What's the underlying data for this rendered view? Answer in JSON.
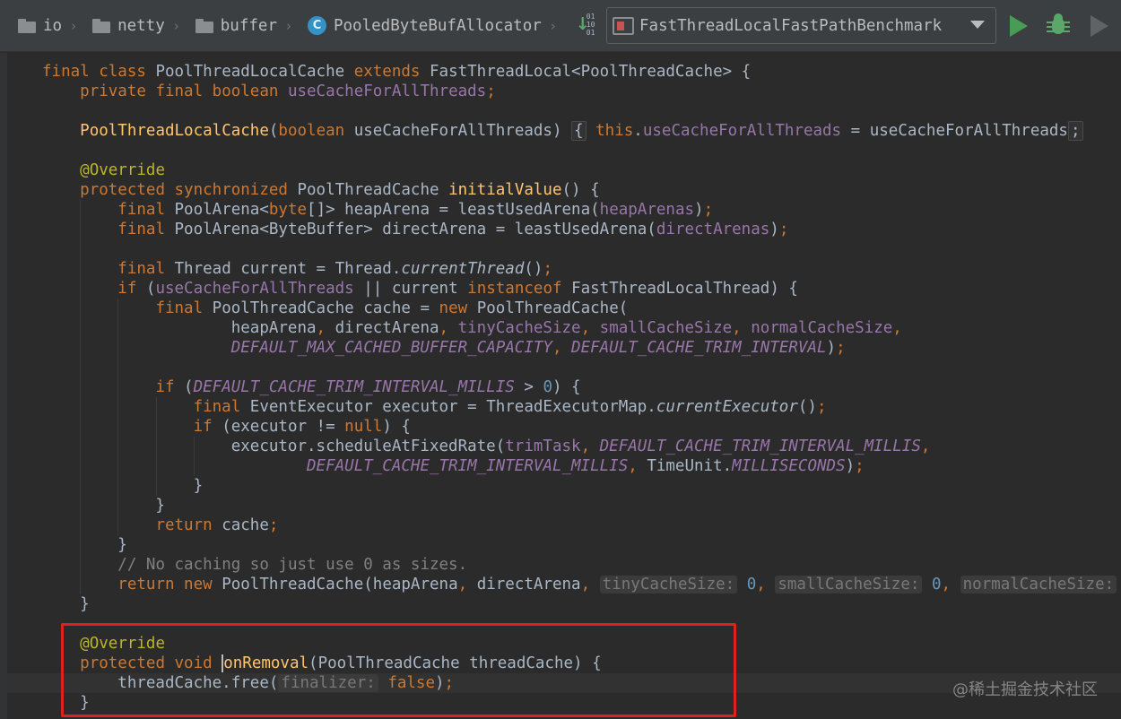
{
  "navbar": {
    "breadcrumbs": [
      {
        "label": "io",
        "icon": "folder-icon"
      },
      {
        "label": "netty",
        "icon": "folder-icon"
      },
      {
        "label": "buffer",
        "icon": "folder-icon"
      },
      {
        "label": "PooledByteBufAllocator",
        "icon": "class-icon",
        "icon_letter": "C"
      }
    ],
    "bits_label": "01\n10\n01",
    "run_config": "FastThreadLocalFastPathBenchmark",
    "run_button": "run-icon",
    "debug_button": "debug-icon",
    "run_coverage_button": "run-disabled-icon"
  },
  "editor": {
    "lines": [
      [
        {
          "t": "final class ",
          "c": "kw"
        },
        {
          "t": "PoolThreadLocalCache "
        },
        {
          "t": "extends ",
          "c": "kw"
        },
        {
          "t": "FastThreadLocal<PoolThreadCache> {"
        }
      ],
      [
        {
          "t": "    "
        },
        {
          "t": "private final boolean ",
          "c": "kw"
        },
        {
          "t": "useCacheForAllThreads",
          "c": "fld"
        },
        {
          "t": ";",
          "c": "kw"
        }
      ],
      [],
      [
        {
          "t": "    "
        },
        {
          "t": "PoolThreadLocalCache",
          "c": "fn"
        },
        {
          "t": "("
        },
        {
          "t": "boolean ",
          "c": "kw"
        },
        {
          "t": "useCacheForAllThreads) "
        },
        {
          "t": "{",
          "c": "fold"
        },
        {
          "t": " "
        },
        {
          "t": "this",
          "c": "kw"
        },
        {
          "t": "."
        },
        {
          "t": "useCacheForAllThreads",
          "c": "fld"
        },
        {
          "t": " = useCacheForAllThreads"
        },
        {
          "t": ";",
          "c": "fold"
        }
      ],
      [],
      [
        {
          "t": "    "
        },
        {
          "t": "@Override",
          "c": "ann"
        }
      ],
      [
        {
          "t": "    "
        },
        {
          "t": "protected synchronized ",
          "c": "kw"
        },
        {
          "t": "PoolThreadCache "
        },
        {
          "t": "initialValue",
          "c": "fn"
        },
        {
          "t": "() {"
        }
      ],
      [
        {
          "t": "        "
        },
        {
          "t": "final ",
          "c": "kw"
        },
        {
          "t": "PoolArena<"
        },
        {
          "t": "byte",
          "c": "kw"
        },
        {
          "t": "[]> heapArena = leastUsedArena("
        },
        {
          "t": "heapArenas",
          "c": "fld"
        },
        {
          "t": ")"
        },
        {
          "t": ";",
          "c": "kw"
        }
      ],
      [
        {
          "t": "        "
        },
        {
          "t": "final ",
          "c": "kw"
        },
        {
          "t": "PoolArena<ByteBuffer> directArena = leastUsedArena("
        },
        {
          "t": "directArenas",
          "c": "fld"
        },
        {
          "t": ")"
        },
        {
          "t": ";",
          "c": "kw"
        }
      ],
      [],
      [
        {
          "t": "        "
        },
        {
          "t": "final ",
          "c": "kw"
        },
        {
          "t": "Thread current = Thread."
        },
        {
          "t": "currentThread",
          "c": "mth-i"
        },
        {
          "t": "()"
        },
        {
          "t": ";",
          "c": "kw"
        }
      ],
      [
        {
          "t": "        "
        },
        {
          "t": "if ",
          "c": "kw"
        },
        {
          "t": "("
        },
        {
          "t": "useCacheForAllThreads",
          "c": "fld"
        },
        {
          "t": " || current "
        },
        {
          "t": "instanceof ",
          "c": "kw"
        },
        {
          "t": "FastThreadLocalThread) {"
        }
      ],
      [
        {
          "t": "            "
        },
        {
          "t": "final ",
          "c": "kw"
        },
        {
          "t": "PoolThreadCache cache = "
        },
        {
          "t": "new ",
          "c": "kw"
        },
        {
          "t": "PoolThreadCache("
        }
      ],
      [
        {
          "t": "                    heapArena"
        },
        {
          "t": ", ",
          "c": "kw"
        },
        {
          "t": "directArena"
        },
        {
          "t": ", ",
          "c": "kw"
        },
        {
          "t": "tinyCacheSize",
          "c": "fld"
        },
        {
          "t": ", ",
          "c": "kw"
        },
        {
          "t": "smallCacheSize",
          "c": "fld"
        },
        {
          "t": ", ",
          "c": "kw"
        },
        {
          "t": "normalCacheSize",
          "c": "fld"
        },
        {
          "t": ",",
          "c": "kw"
        }
      ],
      [
        {
          "t": "                    "
        },
        {
          "t": "DEFAULT_MAX_CACHED_BUFFER_CAPACITY",
          "c": "cst"
        },
        {
          "t": ", ",
          "c": "kw"
        },
        {
          "t": "DEFAULT_CACHE_TRIM_INTERVAL",
          "c": "cst"
        },
        {
          "t": ")"
        },
        {
          "t": ";",
          "c": "kw"
        }
      ],
      [],
      [
        {
          "t": "            "
        },
        {
          "t": "if ",
          "c": "kw"
        },
        {
          "t": "("
        },
        {
          "t": "DEFAULT_CACHE_TRIM_INTERVAL_MILLIS",
          "c": "cst"
        },
        {
          "t": " > "
        },
        {
          "t": "0",
          "c": "num"
        },
        {
          "t": ") {"
        }
      ],
      [
        {
          "t": "                "
        },
        {
          "t": "final ",
          "c": "kw"
        },
        {
          "t": "EventExecutor executor = ThreadExecutorMap."
        },
        {
          "t": "currentExecutor",
          "c": "mth-i"
        },
        {
          "t": "()"
        },
        {
          "t": ";",
          "c": "kw"
        }
      ],
      [
        {
          "t": "                "
        },
        {
          "t": "if ",
          "c": "kw"
        },
        {
          "t": "(executor != "
        },
        {
          "t": "null",
          "c": "kw"
        },
        {
          "t": ") {"
        }
      ],
      [
        {
          "t": "                    executor.scheduleAtFixedRate("
        },
        {
          "t": "trimTask",
          "c": "fld"
        },
        {
          "t": ", ",
          "c": "kw"
        },
        {
          "t": "DEFAULT_CACHE_TRIM_INTERVAL_MILLIS",
          "c": "cst"
        },
        {
          "t": ",",
          "c": "kw"
        }
      ],
      [
        {
          "t": "                            "
        },
        {
          "t": "DEFAULT_CACHE_TRIM_INTERVAL_MILLIS",
          "c": "cst"
        },
        {
          "t": ", ",
          "c": "kw"
        },
        {
          "t": "TimeUnit."
        },
        {
          "t": "MILLISECONDS",
          "c": "cst"
        },
        {
          "t": ")"
        },
        {
          "t": ";",
          "c": "kw"
        }
      ],
      [
        {
          "t": "                }"
        }
      ],
      [
        {
          "t": "            }"
        }
      ],
      [
        {
          "t": "            "
        },
        {
          "t": "return ",
          "c": "kw"
        },
        {
          "t": "cache"
        },
        {
          "t": ";",
          "c": "kw"
        }
      ],
      [
        {
          "t": "        }"
        }
      ],
      [
        {
          "t": "        "
        },
        {
          "t": "// No caching so just use 0 as sizes.",
          "c": "cmt"
        }
      ],
      [
        {
          "t": "        "
        },
        {
          "t": "return new ",
          "c": "kw"
        },
        {
          "t": "PoolThreadCache(heapArena"
        },
        {
          "t": ", ",
          "c": "kw"
        },
        {
          "t": "directArena"
        },
        {
          "t": ", ",
          "c": "kw"
        },
        {
          "t": "tinyCacheSize:",
          "c": "hint"
        },
        {
          "t": " "
        },
        {
          "t": "0",
          "c": "num"
        },
        {
          "t": ", ",
          "c": "kw"
        },
        {
          "t": "smallCacheSize:",
          "c": "hint"
        },
        {
          "t": " "
        },
        {
          "t": "0",
          "c": "num"
        },
        {
          "t": ", ",
          "c": "kw"
        },
        {
          "t": "normalCacheSize:",
          "c": "hint"
        }
      ],
      [
        {
          "t": "    }"
        }
      ],
      [],
      [
        {
          "t": "    "
        },
        {
          "t": "@Override",
          "c": "ann"
        }
      ],
      [
        {
          "t": "    "
        },
        {
          "t": "protected void ",
          "c": "kw"
        },
        {
          "t": "o",
          "c": "fn caret"
        },
        {
          "t": "nRemoval",
          "c": "fn"
        },
        {
          "t": "(PoolThreadCache threadCache) {"
        }
      ],
      [
        {
          "t": "        threadCache.free("
        },
        {
          "t": "finalizer:",
          "c": "hint"
        },
        {
          "t": " "
        },
        {
          "t": "false",
          "c": "kw"
        },
        {
          "t": ")"
        },
        {
          "t": ";",
          "c": "kw"
        }
      ],
      [
        {
          "t": "    }"
        }
      ]
    ],
    "caret_line": 31
  },
  "watermark": "@稀土掘金技术社区"
}
